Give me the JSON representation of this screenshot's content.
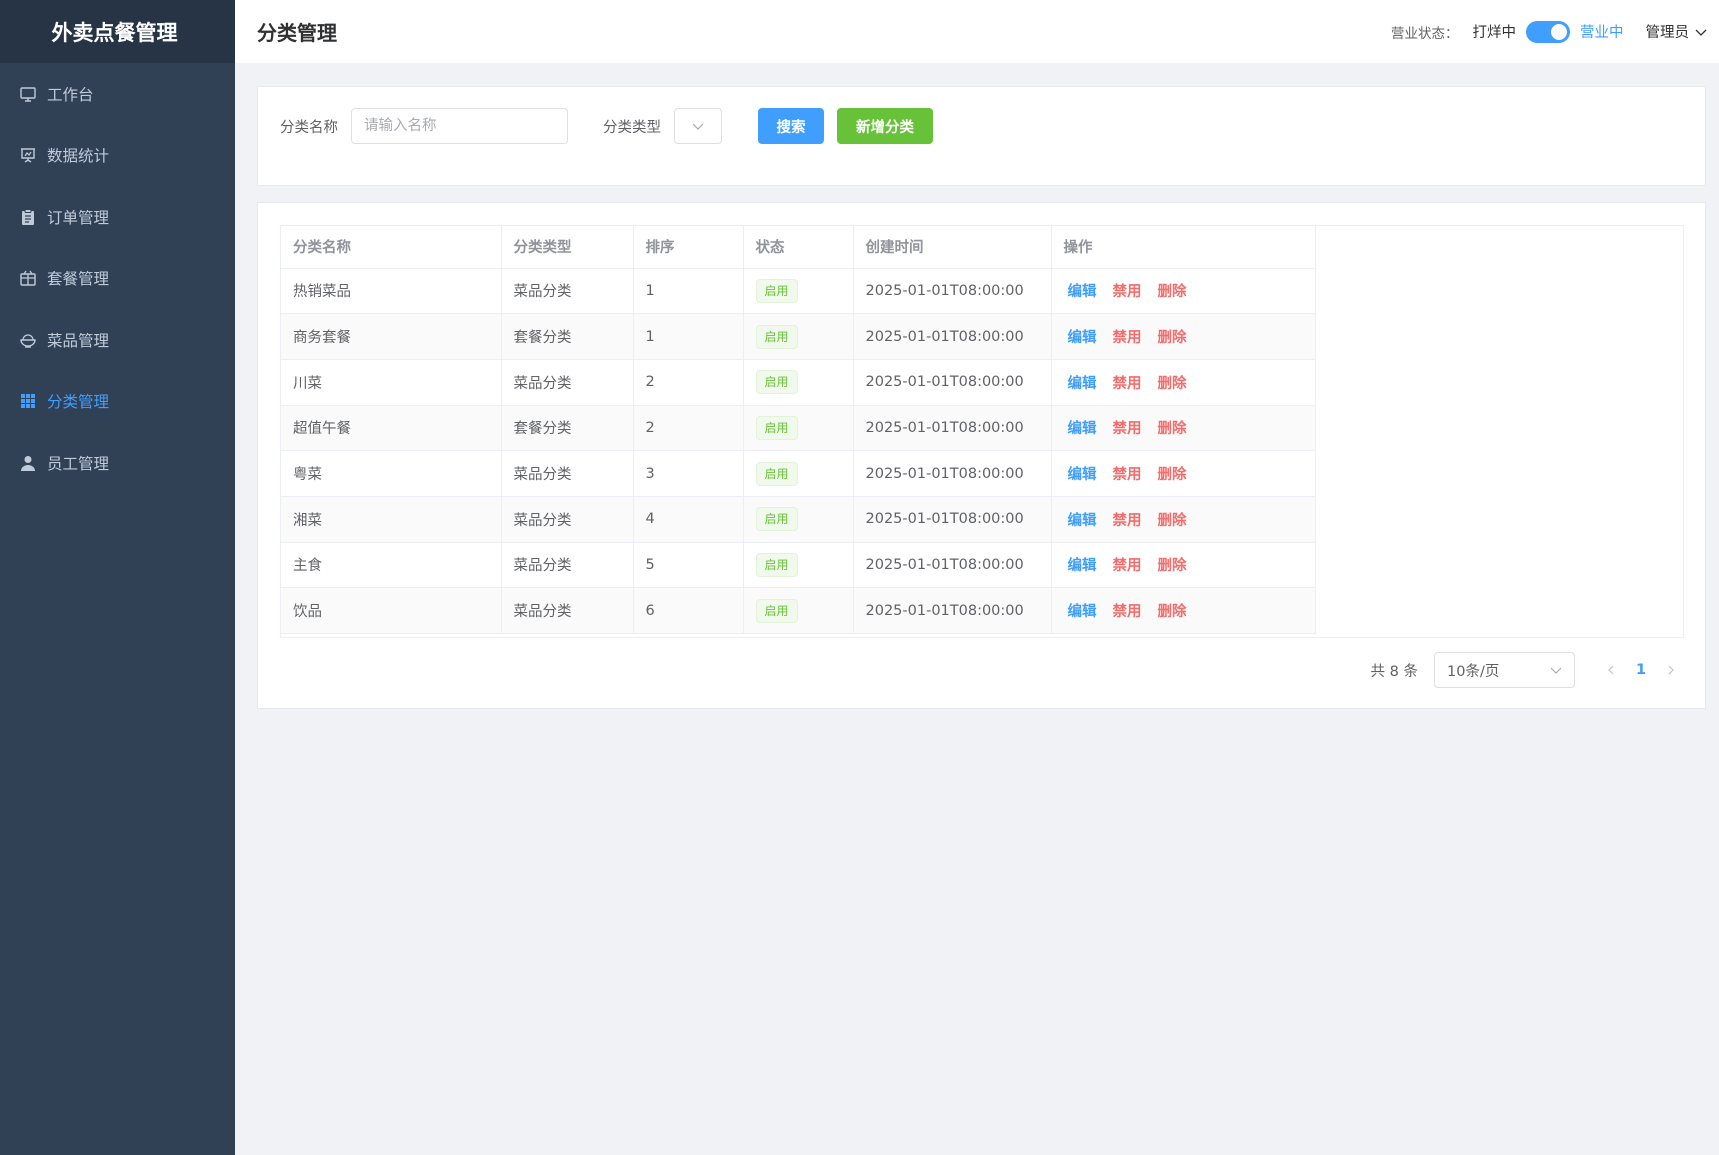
{
  "app": {
    "title": "外卖点餐管理"
  },
  "sidebar": {
    "items": [
      {
        "label": "工作台",
        "icon": "monitor-icon",
        "active": false
      },
      {
        "label": "数据统计",
        "icon": "chart-board-icon",
        "active": false
      },
      {
        "label": "订单管理",
        "icon": "clipboard-icon",
        "active": false
      },
      {
        "label": "套餐管理",
        "icon": "box-icon",
        "active": false
      },
      {
        "label": "菜品管理",
        "icon": "bowl-icon",
        "active": false
      },
      {
        "label": "分类管理",
        "icon": "grid-icon",
        "active": true
      },
      {
        "label": "员工管理",
        "icon": "user-icon",
        "active": false
      }
    ]
  },
  "header": {
    "title": "分类管理",
    "status_label": "营业状态：",
    "status_off": "打烊中",
    "status_on": "营业中",
    "user": "管理员"
  },
  "filters": {
    "name_label": "分类名称",
    "name_placeholder": "请输入名称",
    "name_value": "",
    "type_label": "分类类型",
    "type_value": "",
    "search_btn": "搜索",
    "add_btn": "新增分类"
  },
  "table": {
    "columns": [
      "分类名称",
      "分类类型",
      "排序",
      "状态",
      "创建时间",
      "操作"
    ],
    "rows": [
      {
        "name": "热销菜品",
        "type": "菜品分类",
        "sort": "1",
        "status": "启用",
        "created": "2025-01-01T08:00:00"
      },
      {
        "name": "商务套餐",
        "type": "套餐分类",
        "sort": "1",
        "status": "启用",
        "created": "2025-01-01T08:00:00"
      },
      {
        "name": "川菜",
        "type": "菜品分类",
        "sort": "2",
        "status": "启用",
        "created": "2025-01-01T08:00:00"
      },
      {
        "name": "超值午餐",
        "type": "套餐分类",
        "sort": "2",
        "status": "启用",
        "created": "2025-01-01T08:00:00"
      },
      {
        "name": "粤菜",
        "type": "菜品分类",
        "sort": "3",
        "status": "启用",
        "created": "2025-01-01T08:00:00"
      },
      {
        "name": "湘菜",
        "type": "菜品分类",
        "sort": "4",
        "status": "启用",
        "created": "2025-01-01T08:00:00"
      },
      {
        "name": "主食",
        "type": "菜品分类",
        "sort": "5",
        "status": "启用",
        "created": "2025-01-01T08:00:00"
      },
      {
        "name": "饮品",
        "type": "菜品分类",
        "sort": "6",
        "status": "启用",
        "created": "2025-01-01T08:00:00"
      }
    ],
    "actions": {
      "edit": "编辑",
      "disable": "禁用",
      "delete": "删除"
    }
  },
  "pagination": {
    "total_text": "共 8 条",
    "page_size": "10条/页",
    "current_page": "1"
  },
  "colors": {
    "sidebar_bg": "#304156",
    "logo_bg": "#263445",
    "primary": "#409eff",
    "success": "#67c23a",
    "danger": "#f56c6c"
  }
}
